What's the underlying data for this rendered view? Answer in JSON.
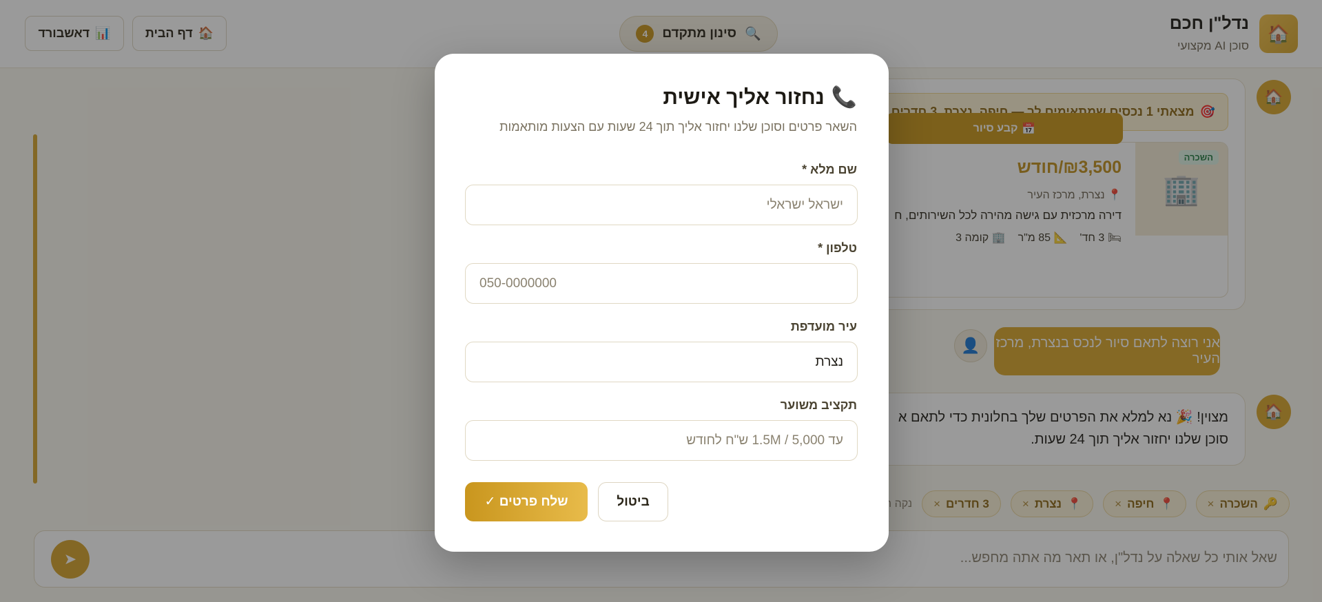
{
  "brand": {
    "title": "נדל\"ן חכם",
    "subtitle": "סוכן AI מקצועי",
    "logo_icon": "🏠"
  },
  "header": {
    "filter_label": "סינון מתקדם",
    "filter_count": "4",
    "filter_icon": "🔍",
    "home_label": "דף הבית",
    "home_icon": "🏠",
    "dashboard_label": "דאשבורד",
    "dashboard_icon": "📊"
  },
  "chat": {
    "bot_icon": "🏠",
    "banner_icon": "🎯",
    "banner_text": "מצאתי 1 נכסים שמתאימים לך — חיפה, נצרת, 3 חדרים",
    "property": {
      "badge": "השכרה",
      "image_icon": "🏢",
      "price": "₪3,500/חודש",
      "location_icon": "📍",
      "location": "נצרת, מרכז העיר",
      "description": "דירה מרכזית עם גישה מהירה לכל השירותים, ח",
      "rooms_icon": "🛏",
      "rooms": "3 חד'",
      "area_icon": "📐",
      "area": "85 מ\"ר",
      "floor_icon": "🏢",
      "floor": "קומה 3",
      "tour_icon": "📅",
      "tour_label": "קבע סיור"
    },
    "user_message": "אני רוצה לתאם סיור לנכס בנצרת, מרכז העיר",
    "user_icon": "👤",
    "bot_message_line1": "מצוין! 🎉 נא למלא את הפרטים שלך בחלונית כדי לתאם א",
    "bot_message_line2": "סוכן שלנו יחזור אליך תוך 24 שעות.",
    "chips": [
      {
        "icon": "🔑",
        "label": "השכרה"
      },
      {
        "icon": "📍",
        "label": "חיפה"
      },
      {
        "icon": "📍",
        "label": "נצרת"
      },
      {
        "icon": "",
        "label": "3 חדרים"
      }
    ],
    "chip_remove": "×",
    "clear_label": "נקה הכ",
    "input_placeholder": "שאל אותי כל שאלה על נדל\"ן, או תאר מה אתה מחפש...",
    "send_icon": "➤"
  },
  "modal": {
    "title_icon": "📞",
    "title": "נחזור אליך אישית",
    "subtitle": "השאר פרטים וסוכן שלנו יחזור אליך תוך 24 שעות עם הצעות מותאמות",
    "name_label": "שם מלא *",
    "name_placeholder": "ישראל ישראלי",
    "phone_label": "טלפון *",
    "phone_placeholder": "050-0000000",
    "city_label": "עיר מועדפת",
    "city_value": "נצרת",
    "budget_label": "תקציב משוער",
    "budget_placeholder": "עד 5,000 / 1.5M ש\"ח לחודש",
    "cancel_label": "ביטול",
    "submit_label": "שלח פרטים ✓"
  }
}
